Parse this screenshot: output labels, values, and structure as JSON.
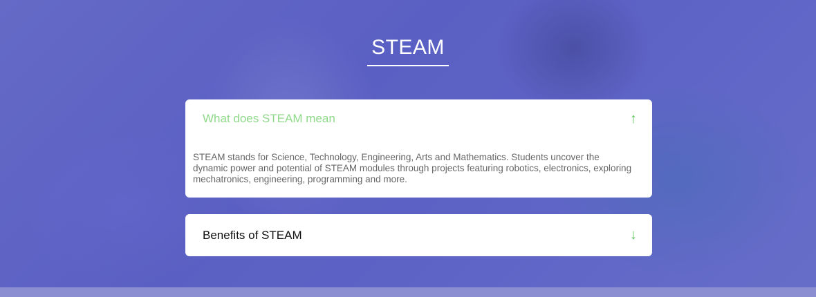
{
  "section": {
    "title": "STEAM"
  },
  "accordion": [
    {
      "question": "What does STEAM mean",
      "expanded": true,
      "toggle_icon": "arrow-up-icon",
      "answer": "STEAM stands for Science, Technology, Engineering, Arts and Mathematics. Students uncover the dynamic power and potential of STEAM modules through projects featuring robotics, electronics, exploring mechatronics, engineering, programming and more."
    },
    {
      "question": "Benefits of STEAM",
      "expanded": false,
      "toggle_icon": "arrow-down-icon"
    }
  ],
  "colors": {
    "overlay": "#5c60c8",
    "active_question": "#8fd98a",
    "arrow": "#5cc55a",
    "card": "#ffffff"
  }
}
